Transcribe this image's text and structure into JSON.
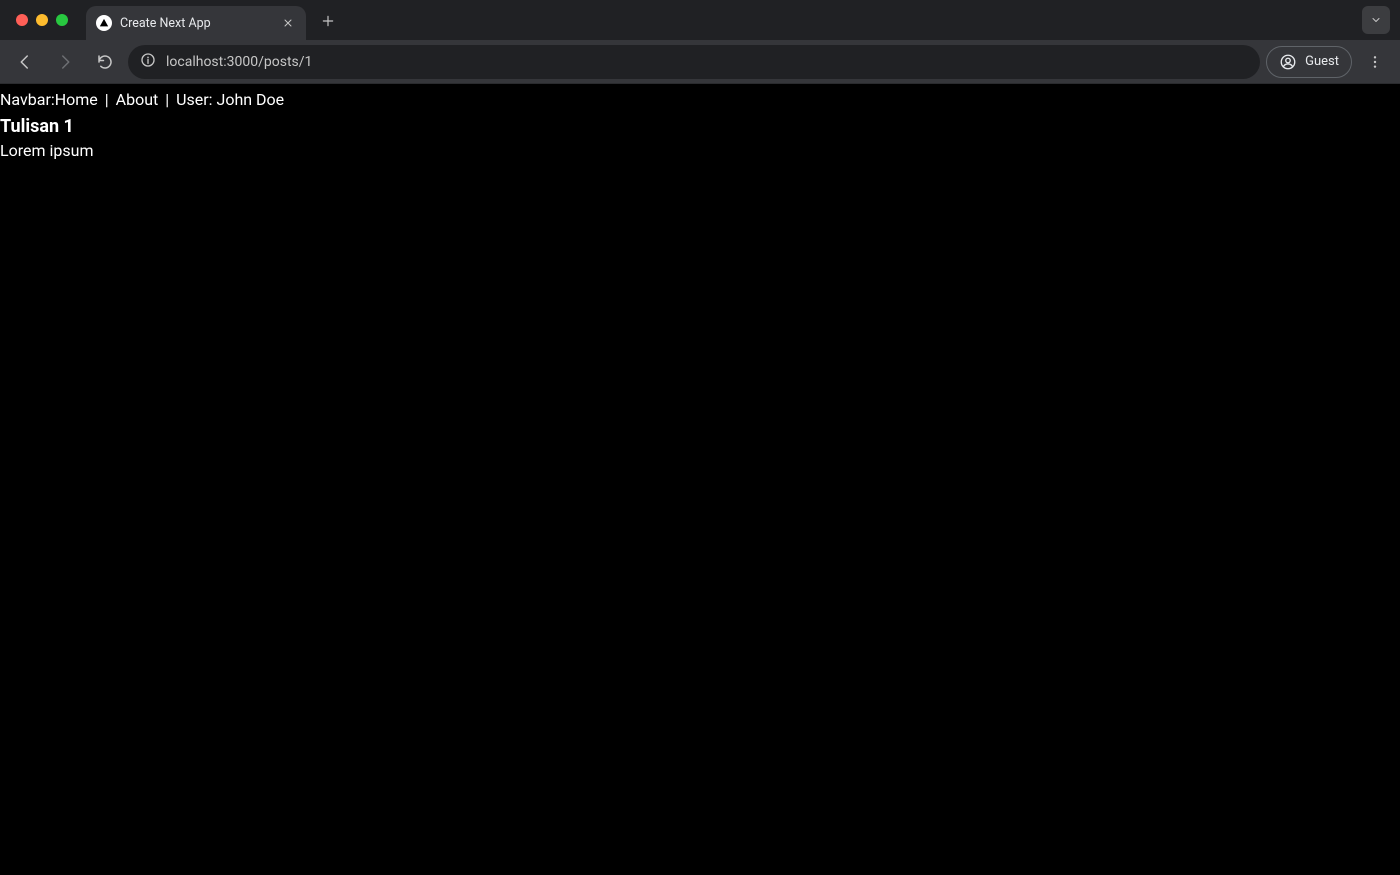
{
  "browser": {
    "tab_title": "Create Next App",
    "url": "localhost:3000/posts/1",
    "guest_label": "Guest"
  },
  "page": {
    "navbar": {
      "prefix": "Navbar:",
      "links": {
        "home": "Home",
        "about": "About"
      },
      "separator": "|",
      "user_label": "User:",
      "user_name": "John Doe"
    },
    "post": {
      "title": "Tulisan 1",
      "body": "Lorem ipsum"
    }
  }
}
